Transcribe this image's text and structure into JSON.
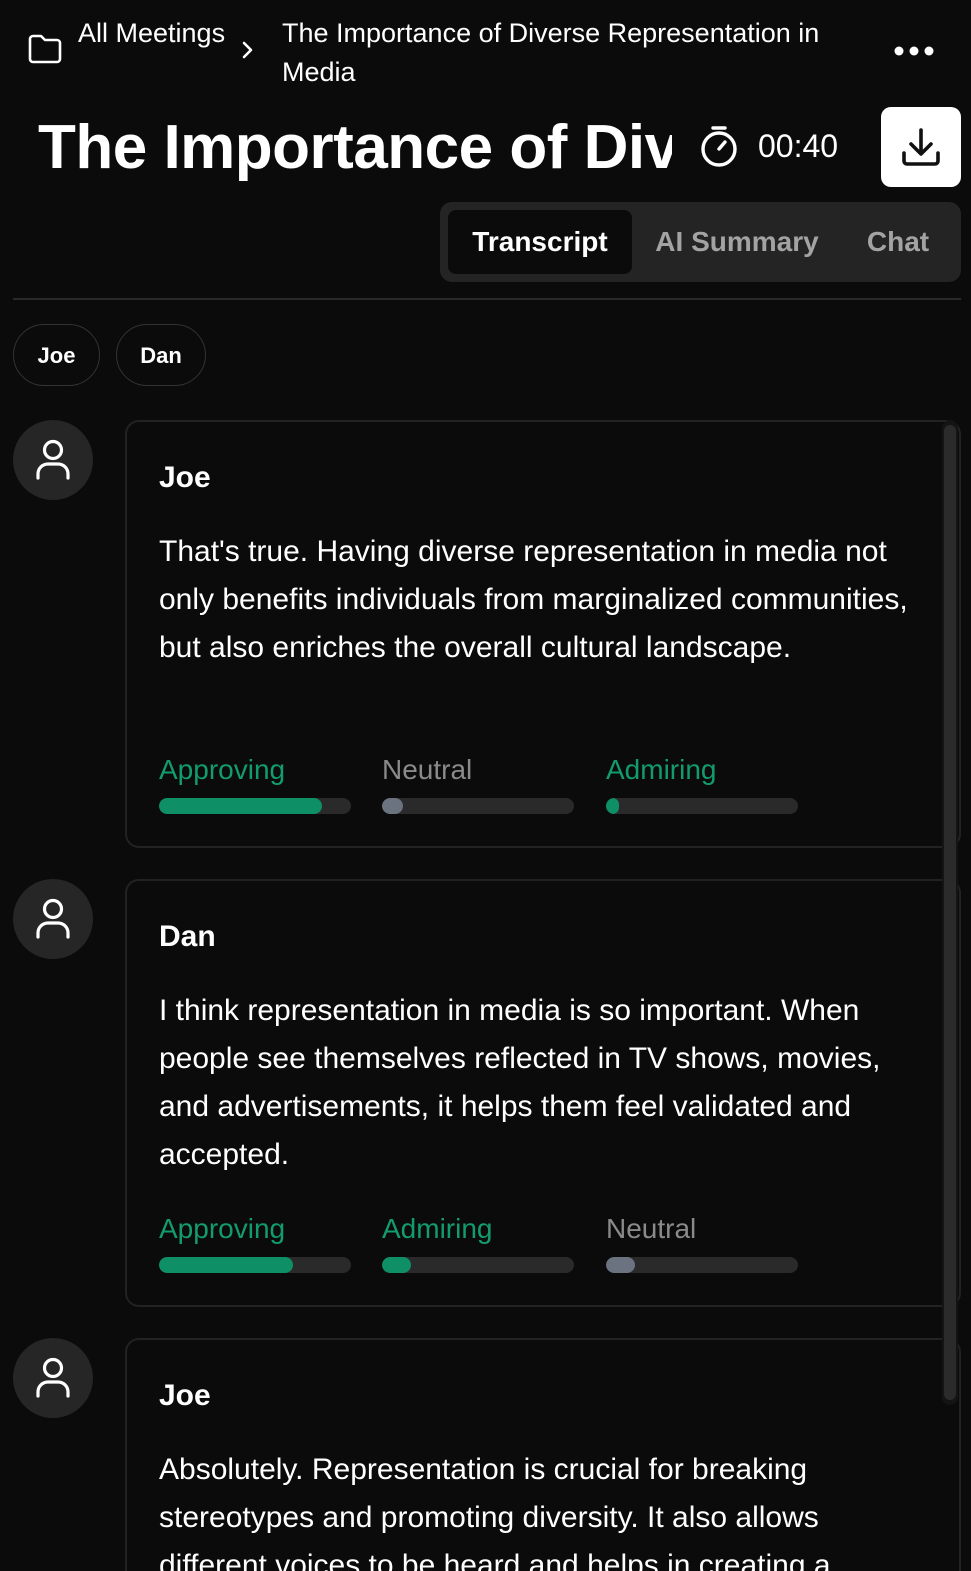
{
  "breadcrumb": {
    "parent": "All Meetings",
    "current": "The Importance of Diverse Representation in Media"
  },
  "header": {
    "title": "The Importance of Diverse Representation in Media",
    "timer": "00:40"
  },
  "tabs": {
    "transcript": "Transcript",
    "ai_summary": "AI Summary",
    "chat": "Chat"
  },
  "speakers": [
    "Joe",
    "Dan"
  ],
  "messages": [
    {
      "speaker": "Joe",
      "text": "That's true. Having diverse representation in media not only benefits individuals from marginalized communities, but also enriches the overall cultural landscape.",
      "emotions": [
        {
          "label": "Approving",
          "level": 0.85,
          "color": "#129c6e"
        },
        {
          "label": "Neutral",
          "level": 0.11,
          "color": "#6b7280"
        },
        {
          "label": "Admiring",
          "level": 0.07,
          "color": "#129c6e"
        }
      ]
    },
    {
      "speaker": "Dan",
      "text": "I think representation in media is so important. When people see themselves reflected in TV shows, movies, and advertisements, it helps them feel validated and accepted.",
      "emotions": [
        {
          "label": "Approving",
          "level": 0.7,
          "color": "#129c6e"
        },
        {
          "label": "Admiring",
          "level": 0.15,
          "color": "#129c6e"
        },
        {
          "label": "Neutral",
          "level": 0.15,
          "color": "#6b7280"
        }
      ]
    },
    {
      "speaker": "Joe",
      "text": "Absolutely. Representation is crucial for breaking stereotypes and promoting diversity. It also allows different voices to be heard and helps in creating a"
    }
  ],
  "icons": {
    "folder": "folder-icon",
    "separator": "chevron-right-icon",
    "more": "more-horizontal-icon",
    "timer": "stopwatch-icon",
    "download": "download-icon",
    "avatar": "user-icon"
  }
}
